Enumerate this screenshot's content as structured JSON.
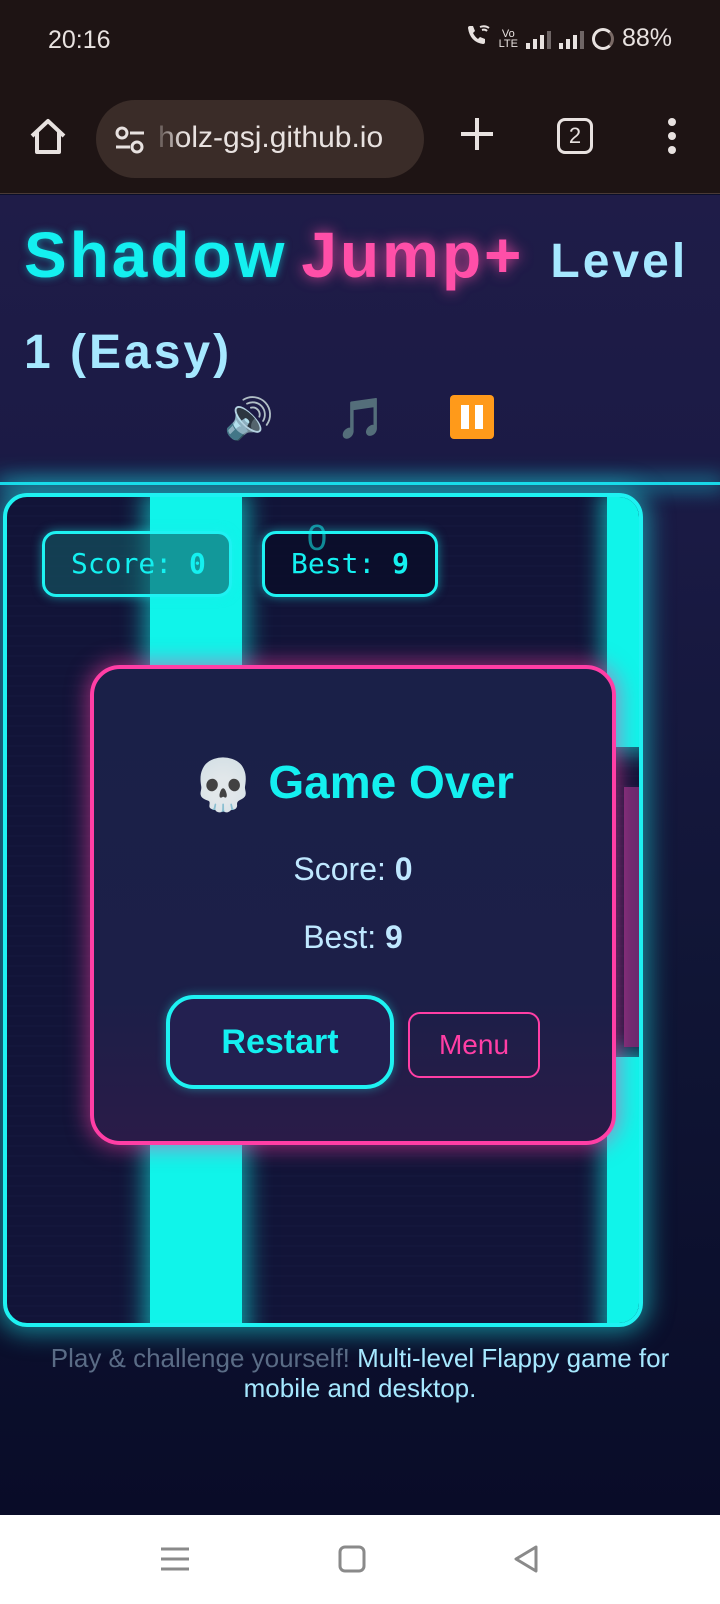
{
  "status": {
    "time": "20:16",
    "battery": "88%"
  },
  "browser": {
    "url": "holz-gsj.github.io",
    "tab_count": "2"
  },
  "title": {
    "part1": "Shadow",
    "part2": "Jump+",
    "level": "Level 1 (Easy)"
  },
  "controls": {
    "sound": "🔊",
    "music": "🎵"
  },
  "hud": {
    "score_label": "Score: ",
    "score": "0",
    "best_label": "Best: ",
    "best": "9",
    "center_score": "0"
  },
  "modal": {
    "skull": "💀",
    "title": "Game Over",
    "score_label": "Score: ",
    "score": "0",
    "best_label": "Best: ",
    "best": "9",
    "restart": "Restart",
    "menu": "Menu"
  },
  "footer": {
    "dim": "Play & challenge yourself!",
    "bright": " Multi-level Flappy game for mobile and desktop."
  },
  "colors": {
    "cyan": "#14f0f0",
    "pink": "#ff4fa8",
    "pause": "#ff9a1a",
    "bg": "#1a1a44"
  }
}
